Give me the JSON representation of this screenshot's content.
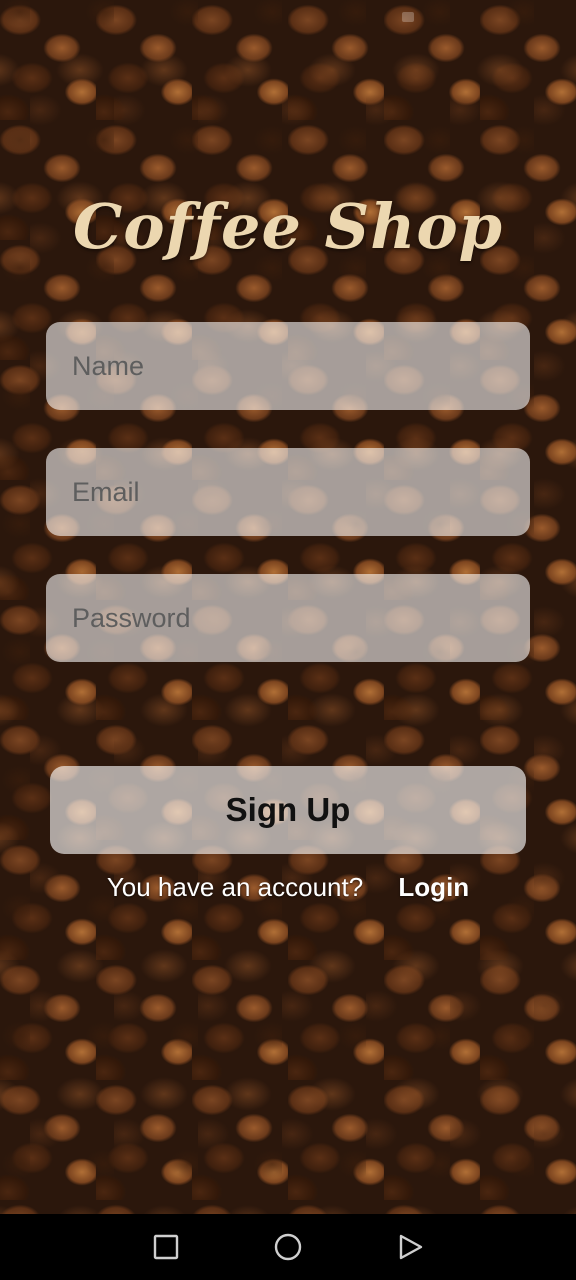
{
  "app": {
    "title": "Coffee Shop"
  },
  "form": {
    "name_placeholder": "Name",
    "email_placeholder": "Email",
    "password_placeholder": "Password",
    "name_value": "",
    "email_value": "",
    "password_value": ""
  },
  "actions": {
    "signup_label": "Sign Up",
    "login_question": "You have an account?",
    "login_link": "Login"
  },
  "nav": {
    "icons": [
      "recent-apps-icon",
      "home-icon",
      "back-icon"
    ]
  },
  "colors": {
    "title": "#ecd7b0",
    "field_bg": "rgba(255,255,255,0.58)",
    "navbar": "#000000"
  }
}
